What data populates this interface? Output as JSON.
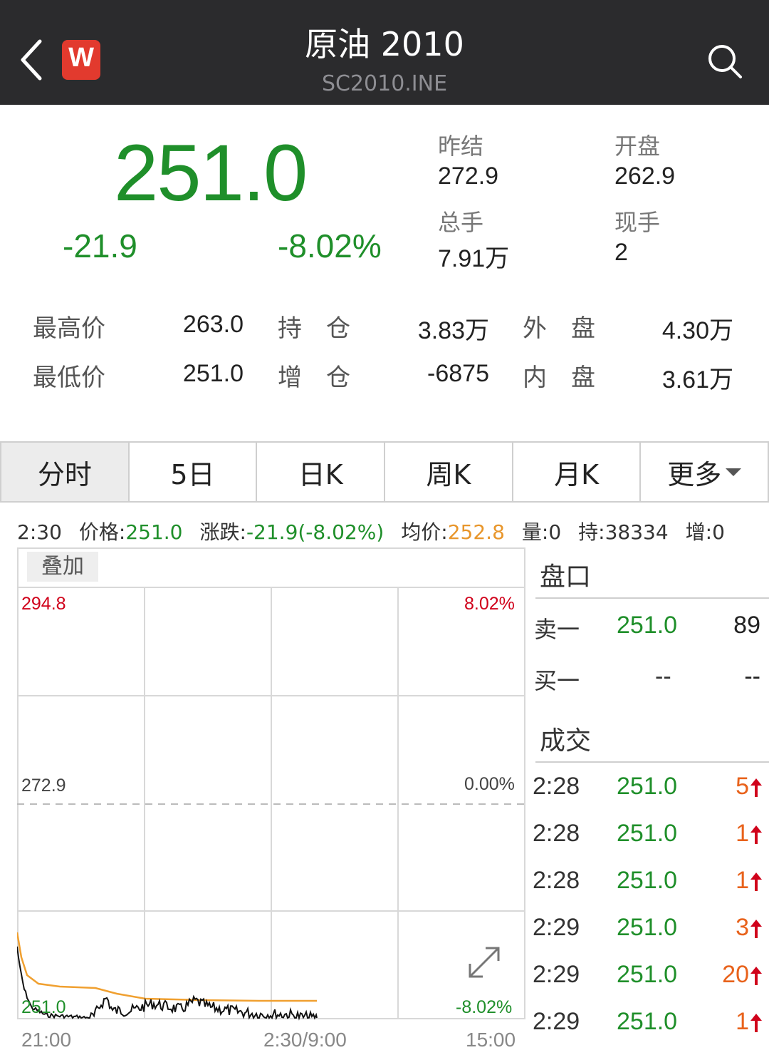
{
  "header": {
    "title": "原油 2010",
    "subtitle": "SC2010.INE",
    "logo_letter": "W"
  },
  "quote": {
    "price": "251.0",
    "change": "-21.9",
    "change_pct": "-8.02%",
    "stats": [
      {
        "label": "昨结",
        "value": "272.9"
      },
      {
        "label": "开盘",
        "value": "262.9"
      },
      {
        "label": "总手",
        "value": "7.91万"
      },
      {
        "label": "现手",
        "value": "2"
      }
    ],
    "detail_rows": [
      [
        {
          "label": "最高价",
          "value": "263.0"
        },
        {
          "label": "持　仓",
          "value": "3.83万"
        },
        {
          "label": "外　盘",
          "value": "4.30万"
        }
      ],
      [
        {
          "label": "最低价",
          "value": "251.0"
        },
        {
          "label": "增　仓",
          "value": "-6875"
        },
        {
          "label": "内　盘",
          "value": "3.61万"
        }
      ]
    ]
  },
  "tabs": [
    {
      "label": "分时"
    },
    {
      "label": "5日"
    },
    {
      "label": "日K"
    },
    {
      "label": "周K"
    },
    {
      "label": "月K"
    },
    {
      "label": "更多"
    }
  ],
  "infobar": {
    "time": "2:30",
    "price_label": "价格:",
    "price": "251.0",
    "change_label": "涨跌:",
    "change": "-21.9(-8.02%)",
    "avg_label": "均价:",
    "avg": "252.8",
    "volume": "量:0",
    "hold": "持:38334",
    "increase": "增:0"
  },
  "chart": {
    "overlay_label": "叠加",
    "y_top_left": "294.8",
    "y_top_right": "8.02%",
    "y_mid_left": "272.9",
    "y_mid_right": "0.00%",
    "y_bottom_left": "251.0",
    "y_bottom_right": "-8.02%",
    "x_labels": [
      "21:00",
      "2:30/9:00",
      "15:00"
    ],
    "colors": {
      "up": "#d0021b",
      "down": "#1f8f2a",
      "avg": "#f0a030",
      "price": "#111111"
    }
  },
  "order_book": {
    "title": "盘口",
    "rows": [
      {
        "label": "卖一",
        "price": "251.0",
        "volume": "89"
      },
      {
        "label": "买一",
        "price": "--",
        "volume": "--"
      }
    ]
  },
  "trades": {
    "title": "成交",
    "rows": [
      {
        "time": "2:28",
        "price": "251.0",
        "volume": "5"
      },
      {
        "time": "2:28",
        "price": "251.0",
        "volume": "1"
      },
      {
        "time": "2:28",
        "price": "251.0",
        "volume": "1"
      },
      {
        "time": "2:29",
        "price": "251.0",
        "volume": "3"
      },
      {
        "time": "2:29",
        "price": "251.0",
        "volume": "20"
      },
      {
        "time": "2:29",
        "price": "251.0",
        "volume": "1"
      }
    ]
  }
}
